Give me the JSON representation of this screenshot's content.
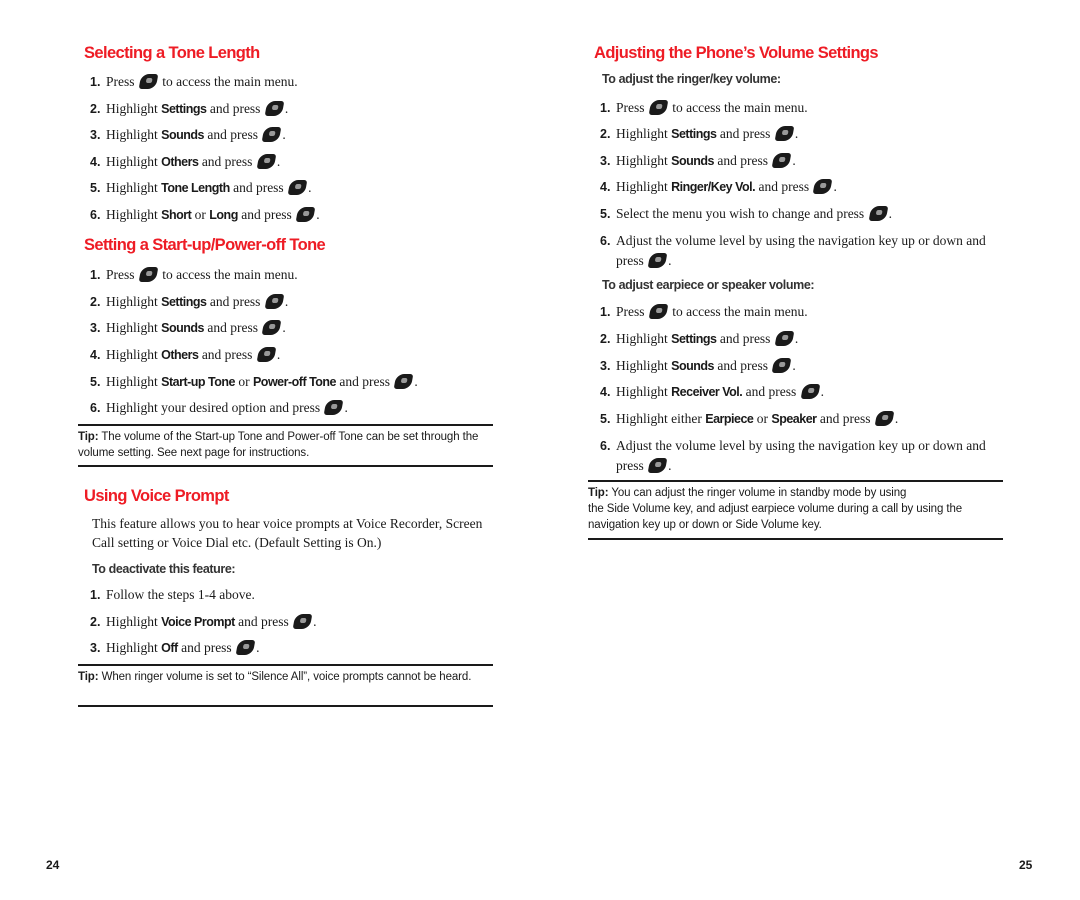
{
  "left_page": {
    "number": "24",
    "sections": {
      "tone_length": {
        "title": "Selecting a Tone Length",
        "steps": [
          {
            "n": "1.",
            "pre": "Press",
            "post": "to access the main menu."
          },
          {
            "n": "2.",
            "pre": "Highlight",
            "bold": "Settings",
            "post": "and press"
          },
          {
            "n": "3.",
            "pre": "Highlight",
            "bold": "Sounds",
            "post": "and press"
          },
          {
            "n": "4.",
            "pre": "Highlight",
            "bold": "Others",
            "post": "and press"
          },
          {
            "n": "5.",
            "pre": "Highlight",
            "bold": "Tone Length",
            "post": "and press"
          },
          {
            "n": "6.",
            "pre": "Highlight",
            "bold": "Short",
            "mid": "or",
            "bold2": "Long",
            "post": "and press"
          }
        ]
      },
      "startup_tone": {
        "title": "Setting a Start-up/Power-off Tone",
        "steps": [
          {
            "n": "1.",
            "pre": "Press",
            "post": "to access the main menu."
          },
          {
            "n": "2.",
            "pre": "Highlight",
            "bold": "Settings",
            "post": "and press"
          },
          {
            "n": "3.",
            "pre": "Highlight",
            "bold": "Sounds",
            "post": "and press"
          },
          {
            "n": "4.",
            "pre": "Highlight",
            "bold": "Others",
            "post": "and press"
          },
          {
            "n": "5.",
            "pre": "Highlight",
            "bold": "Start-up Tone",
            "mid": "or",
            "bold2": "Power-off Tone",
            "post": "and press"
          },
          {
            "n": "6.",
            "pre": "Highlight your desired option and press"
          }
        ],
        "tip_label": "Tip:",
        "tip_text": "The volume of the Start-up Tone and Power-off Tone can be set through the volume setting. See next page for instructions."
      },
      "voice_prompt": {
        "title": "Using Voice Prompt",
        "description": "This feature allows you to hear voice prompts at Voice Recorder, Screen Call setting or Voice Dial etc. (Default Setting is On.)",
        "subheading": "To deactivate this feature:",
        "steps": [
          {
            "n": "1.",
            "pre": "Follow the steps 1-4 above."
          },
          {
            "n": "2.",
            "pre": "Highlight",
            "bold": "Voice Prompt",
            "post": "and press"
          },
          {
            "n": "3.",
            "pre": "Highlight",
            "bold": "Off",
            "post": "and press"
          }
        ],
        "tip_label": "Tip:",
        "tip_text": "When ringer volume is set to “Silence All”, voice prompts cannot be heard."
      }
    }
  },
  "right_page": {
    "number": "25",
    "title": "Adjusting the Phone’s Volume Settings",
    "ringer": {
      "subheading": "To adjust the ringer/key volume:",
      "steps": [
        {
          "n": "1.",
          "pre": "Press",
          "post": "to access the main menu."
        },
        {
          "n": "2.",
          "pre": "Highlight",
          "bold": "Settings",
          "post": "and press"
        },
        {
          "n": "3.",
          "pre": "Highlight",
          "bold": "Sounds",
          "post": "and press"
        },
        {
          "n": "4.",
          "pre": "Highlight",
          "bold": "Ringer/Key Vol.",
          "post": "and press"
        },
        {
          "n": "5.",
          "pre": "Select the menu you wish to change and press"
        },
        {
          "n": "6.",
          "pre": "Adjust the volume level by using the navigation key up or down and press"
        }
      ]
    },
    "earpiece": {
      "subheading": "To adjust earpiece or speaker volume:",
      "steps": [
        {
          "n": "1.",
          "pre": "Press",
          "post": "to access the main menu."
        },
        {
          "n": "2.",
          "pre": "Highlight",
          "bold": "Settings",
          "post": "and press"
        },
        {
          "n": "3.",
          "pre": "Highlight",
          "bold": "Sounds",
          "post": "and press"
        },
        {
          "n": "4.",
          "pre": "Highlight",
          "bold": "Receiver Vol.",
          "post": "and press"
        },
        {
          "n": "5.",
          "pre": "Highlight either",
          "bold": "Earpiece",
          "mid": "or",
          "bold2": "Speaker",
          "post": "and press"
        },
        {
          "n": "6.",
          "pre": "Adjust the volume level by using the navigation key up or down and press"
        }
      ]
    },
    "tip_label": "Tip:",
    "tip_line1": "You can adjust the ringer volume in standby mode by using",
    "tip_line2": "the Side Volume key, and adjust earpiece volume during a call by using the navigation key up or down or Side Volume key."
  },
  "icons": {
    "menu_ok_key": "menu-ok-key-icon"
  },
  "colors": {
    "heading": "#ee1c25",
    "text": "#1a1a1a"
  }
}
